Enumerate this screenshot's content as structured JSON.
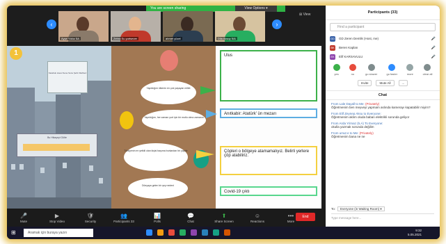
{
  "colors": {
    "accent": "#2d8cff",
    "share_bar": "#2fb344",
    "end": "#e02828",
    "glow": "#e8c35a"
  },
  "top": {
    "sharing_label": "You are screen sharing",
    "view_options": "View Options ▾",
    "view": "⊞ View"
  },
  "thumbs": [
    {
      "name": "Ayşe Yıldız 5A"
    },
    {
      "name": "Zehra Su yurtsever"
    },
    {
      "name": "ahmet yücel"
    },
    {
      "name": "Dila Aksoy 5/A"
    }
  ],
  "slide": {
    "number": "1",
    "sign_top": "Karabuk Lisesi Sene Sonu Şehir Rehberi",
    "sign_mid": "Bu Hikayeyi Gölte",
    "bubbles": [
      "Yapıldığım ülkenin en çok yaşayan millet",
      "Yapıldığım, her zaman yurt için bir mutlu olma zamanın",
      "Türkiyenin en yetkili olan kişisi başıma bunlardan bir yapılır",
      "Dünyaya gelen bir şey nedeni"
    ],
    "answers": [
      "Ulus",
      "Anıtkabir: Atatürk' ün mezarı",
      "Çöpleri o bölgeye atamamalıyız. Belirli yerlere çöp atabiliriz.",
      "Covid-19 çıktı"
    ]
  },
  "toolbar": [
    {
      "icon": "🎤",
      "label": "Mute"
    },
    {
      "icon": "▶",
      "label": "Stop Video"
    },
    {
      "icon": "🛡",
      "label": "Security"
    },
    {
      "icon": "👥",
      "label": "Participants 33"
    },
    {
      "icon": "📊",
      "label": "Polls"
    },
    {
      "icon": "💬",
      "label": "Chat"
    },
    {
      "icon": "⬆",
      "label": "Share Screen"
    },
    {
      "icon": "☺",
      "label": "Reactions"
    },
    {
      "icon": "•••",
      "label": "More"
    }
  ],
  "end_label": "End",
  "participants": {
    "title": "Participants (33)",
    "find_placeholder": "Find a participant",
    "rows": [
      {
        "initials": "GD",
        "color": "#3a62a8",
        "name": "GD Zeren Demlik (Host, me)"
      },
      {
        "initials": "BK",
        "color": "#c0392b",
        "name": "Beren Kaplan"
      },
      {
        "initials": "EK",
        "color": "#8e44ad",
        "name": "Elif KARSAVULU"
      }
    ],
    "reactions": [
      {
        "label": "yes",
        "color": "#3cb14a"
      },
      {
        "label": "no",
        "color": "#e74c3c"
      },
      {
        "label": "go slower",
        "color": "#7f8c8d"
      },
      {
        "label": "go faster",
        "color": "#2d8cff"
      },
      {
        "label": "more",
        "color": "#95a5a6"
      },
      {
        "label": "clear all",
        "color": "#7f8c8d"
      }
    ],
    "invite": "Invite",
    "mute_all": "Mute All",
    "more": "..."
  },
  "chat": {
    "title": "Chat",
    "messages": [
      {
        "from": "From Lale Dayall to Me:",
        "priv": "(Privately)",
        "text": "Öğretmenim ben meyveyi yapmam aslında kamerayı kapatabilir miyim?"
      },
      {
        "from": "From Elif Zeynep Aksu to Everyone:",
        "priv": "",
        "text": "Öğretmenim aklım oluda baban elektrikli sorunda geliyor"
      },
      {
        "from": "From Arda Yılmaz (5.A) To Everyone:",
        "priv": "",
        "text": "okulla yazmak sorunda değilim"
      },
      {
        "from": "From umut e to Me:",
        "priv": "(Privately)",
        "text": "Öğretmenim bana ne ne"
      }
    ],
    "to_label": "To:",
    "to_value": "Everyone (in Waiting Room) ▾",
    "input_placeholder": "Type message here..."
  },
  "taskbar": {
    "search": "Aramak için buraya yazın",
    "time": "9:32",
    "date": "5.05.2021"
  }
}
